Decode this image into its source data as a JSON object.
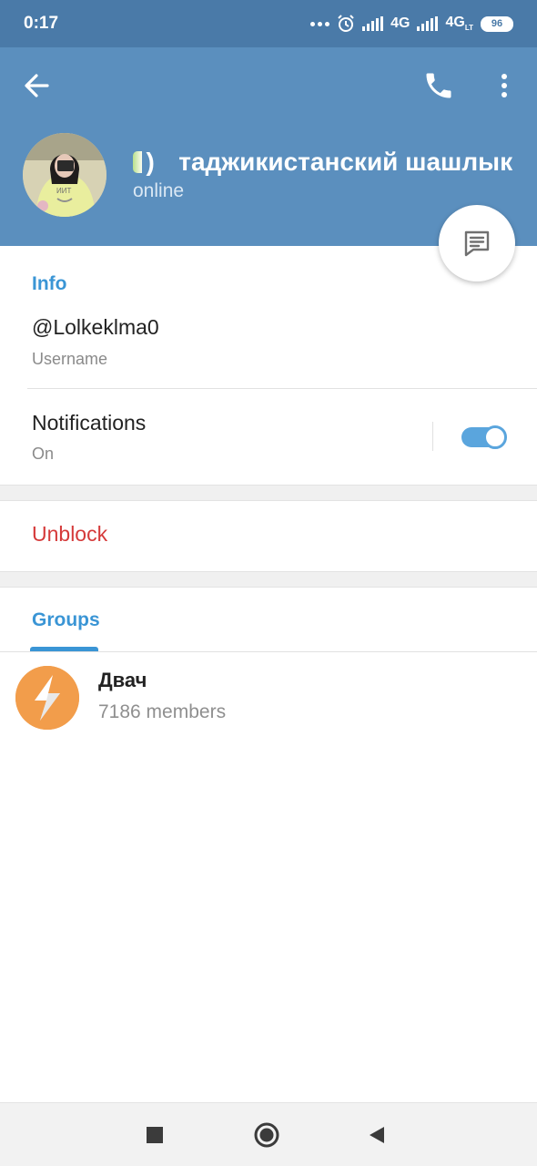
{
  "status_bar": {
    "time": "0:17",
    "network_1": "4G",
    "network_2": "4G",
    "network_2_sub": "LT",
    "battery": "96"
  },
  "header": {
    "name": "таджикистанский шашлык",
    "name_prefix": ")",
    "status": "online",
    "bg_color": "#5b8fbe"
  },
  "info": {
    "title": "Info",
    "username": "@Lolkeklma0",
    "username_label": "Username",
    "notifications_label": "Notifications",
    "notifications_value": "On",
    "notifications_enabled": true
  },
  "actions": {
    "unblock_label": "Unblock",
    "unblock_color": "#d53a3a"
  },
  "groups": {
    "tab_label": "Groups",
    "items": [
      {
        "name": "Двач",
        "members": "7186 members",
        "avatar_color": "#f29d4b"
      }
    ]
  },
  "icons": {
    "back": "arrow-left-icon",
    "call": "phone-icon",
    "more": "more-vertical-icon",
    "message": "message-icon",
    "group": "lightning-icon"
  },
  "accent_color": "#3a95d5"
}
